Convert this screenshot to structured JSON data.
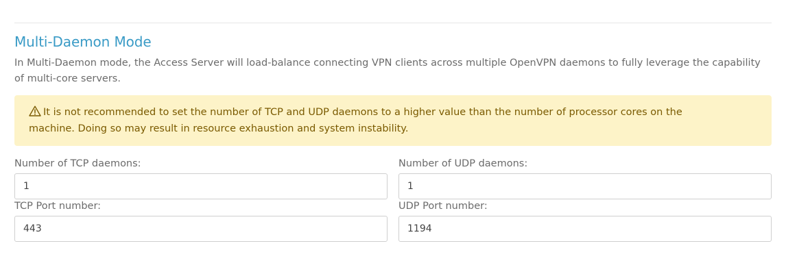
{
  "section": {
    "title": "Multi-Daemon Mode",
    "description": "In Multi-Daemon mode, the Access Server will load-balance connecting VPN clients across multiple OpenVPN daemons to fully leverage the capability of multi-core servers."
  },
  "warning": {
    "icon": "warning-icon",
    "text": "It is not recommended to set the number of TCP and UDP daemons to a higher value than the number of processor cores on the machine. Doing so may result in resource exhaustion and system instability."
  },
  "fields": {
    "tcp_daemons": {
      "label": "Number of TCP daemons:",
      "value": "1"
    },
    "udp_daemons": {
      "label": "Number of UDP daemons:",
      "value": "1"
    },
    "tcp_port": {
      "label": "TCP Port number:",
      "value": "443"
    },
    "udp_port": {
      "label": "UDP Port number:",
      "value": "1194"
    }
  },
  "colors": {
    "title": "#3a9bc6",
    "warning_bg": "#fdf3c8",
    "warning_text": "#7a5a00"
  }
}
